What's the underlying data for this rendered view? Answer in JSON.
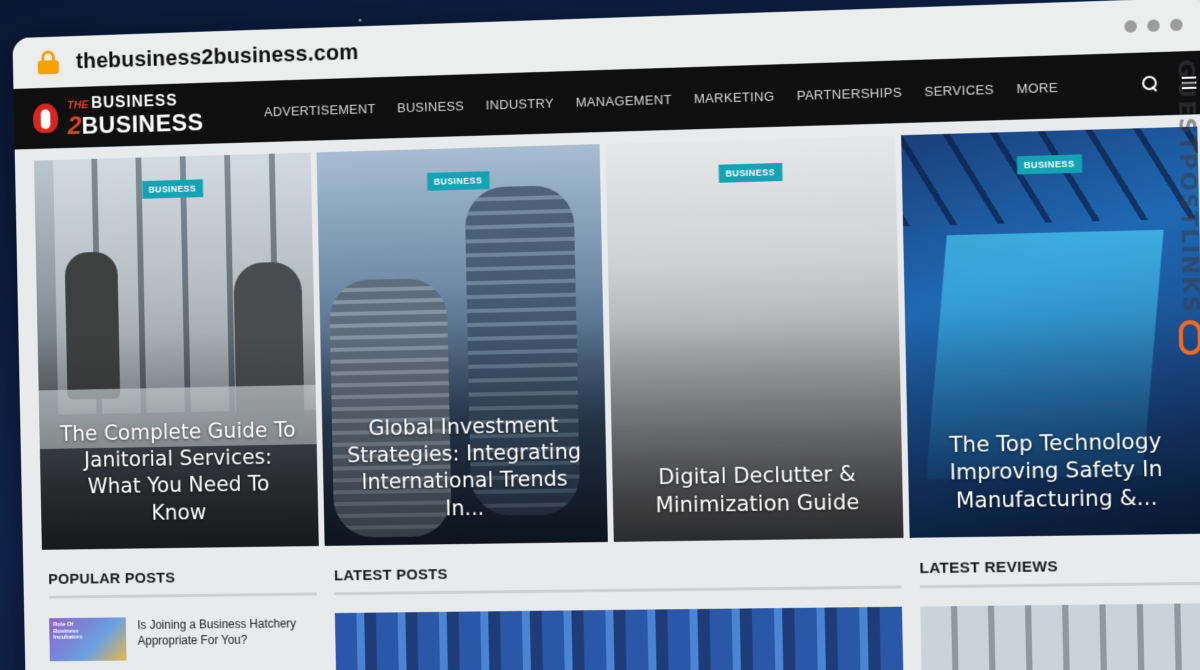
{
  "browser": {
    "url": "thebusiness2business.com"
  },
  "site": {
    "logo": {
      "the": "THE",
      "line1": "BUSINESS",
      "two": "2",
      "line2": "BUSINESS"
    },
    "menu": [
      "ADVERTISEMENT",
      "BUSINESS",
      "INDUSTRY",
      "MANAGEMENT",
      "MARKETING",
      "PARTNERSHIPS",
      "SERVICES",
      "MORE"
    ]
  },
  "hero": [
    {
      "badge": "BUSINESS",
      "title": "The Complete Guide To Janitorial Services: What You Need To Know"
    },
    {
      "badge": "BUSINESS",
      "title": "Global Investment Strategies: Integrating International Trends In..."
    },
    {
      "badge": "BUSINESS",
      "title": "Digital Declutter & Minimization Guide"
    },
    {
      "badge": "BUSINESS",
      "title": "The Top Technology Improving Safety In Manufacturing &..."
    }
  ],
  "sections": {
    "popular": {
      "heading": "POPULAR POSTS",
      "posts": [
        {
          "thumb_text": "Role Of Business Incubators",
          "title": "Is Joining a Business Hatchery Appropriate For You?"
        }
      ]
    },
    "latest": {
      "heading": "LATEST POSTS"
    },
    "reviews": {
      "heading": "LATEST REVIEWS"
    }
  },
  "watermark": {
    "text": "GUESTPOSTLINKS"
  },
  "colors": {
    "badge": "#13a3b3",
    "nav_bg": "#0f0f0f",
    "lock": "#f5a300",
    "logo_red": "#e23a2a"
  }
}
